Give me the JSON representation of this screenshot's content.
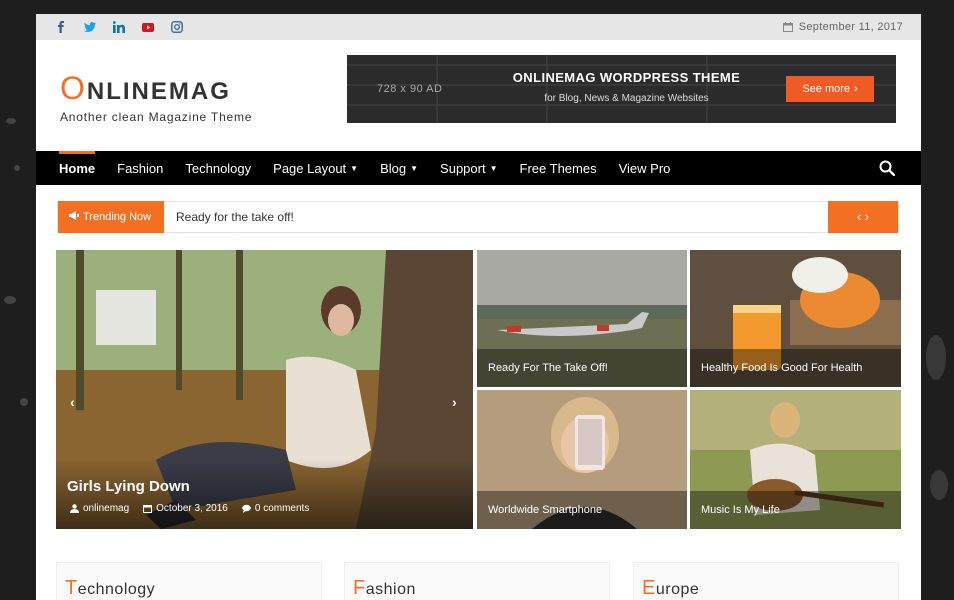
{
  "topbar": {
    "social_icons": [
      "facebook-icon",
      "twitter-icon",
      "linkedin-icon",
      "youtube-icon",
      "instagram-icon"
    ],
    "date": "September 11, 2017"
  },
  "logo": {
    "first_letter": "O",
    "rest": "NLINEMAG",
    "tagline": "Another clean Magazine Theme"
  },
  "ad": {
    "size": "728 x 90 AD",
    "title": "ONLINEMAG WORDPRESS THEME",
    "subtitle": "for Blog, News & Magazine Websites",
    "button": "See more"
  },
  "nav": {
    "items": [
      {
        "label": "Home",
        "dropdown": false,
        "active": true
      },
      {
        "label": "Fashion",
        "dropdown": false
      },
      {
        "label": "Technology",
        "dropdown": false
      },
      {
        "label": "Page Layout",
        "dropdown": true
      },
      {
        "label": "Blog",
        "dropdown": true
      },
      {
        "label": "Support",
        "dropdown": true
      },
      {
        "label": "Free Themes",
        "dropdown": false
      },
      {
        "label": "View Pro",
        "dropdown": false
      }
    ]
  },
  "trending": {
    "label": "Trending Now",
    "headline": "Ready for the take off!",
    "nav_symbol": "‹ ›"
  },
  "featured": {
    "main": {
      "title": "Girls Lying Down",
      "author": "onlinemag",
      "date": "October 3, 2016",
      "comments": "0 comments"
    },
    "tiles": [
      {
        "caption": "Ready For The Take Off!"
      },
      {
        "caption": "Healthy Food Is Good For Health"
      },
      {
        "caption": "Worldwide Smartphone"
      },
      {
        "caption": "Music Is My Life"
      }
    ]
  },
  "sections": [
    {
      "first": "T",
      "rest": "echnology"
    },
    {
      "first": "F",
      "rest": "ashion"
    },
    {
      "first": "E",
      "rest": "urope"
    }
  ],
  "colors": {
    "accent": "#f36f21",
    "nav_bg": "#000000",
    "topbar_bg": "#e6e6e6",
    "ad_bg": "#2b2b2b",
    "ad_button": "#f15a24"
  }
}
